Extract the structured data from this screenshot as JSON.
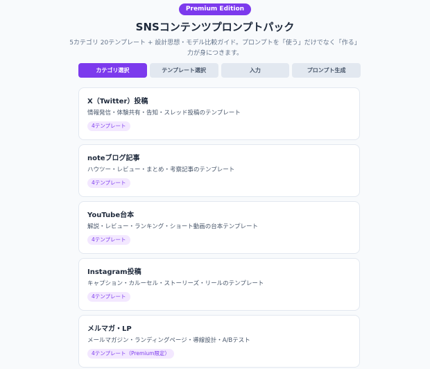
{
  "header": {
    "badge": "Premium Edition",
    "title": "SNSコンテンツプロンプトパック",
    "subtitle": "5カテゴリ 20テンプレート + 設計思想・モデル比較ガイド。プロンプトを「使う」だけでなく「作る」力が身につきます。"
  },
  "steps": [
    {
      "label": "カテゴリ選択",
      "active": true
    },
    {
      "label": "テンプレート選択",
      "active": false
    },
    {
      "label": "入力",
      "active": false
    },
    {
      "label": "プロンプト生成",
      "active": false
    }
  ],
  "categories": [
    {
      "title": "X（Twitter）投稿",
      "desc": "情報発信・体験共有・告知・スレッド投稿のテンプレート",
      "tag": "4テンプレート"
    },
    {
      "title": "noteブログ記事",
      "desc": "ハウツー・レビュー・まとめ・考察記事のテンプレート",
      "tag": "4テンプレート"
    },
    {
      "title": "YouTube台本",
      "desc": "解説・レビュー・ランキング・ショート動画の台本テンプレート",
      "tag": "4テンプレート"
    },
    {
      "title": "Instagram投稿",
      "desc": "キャプション・カルーセル・ストーリーズ・リールのテンプレート",
      "tag": "4テンプレート"
    },
    {
      "title": "メルマガ・LP",
      "desc": "メールマガジン・ランディングページ・導線設計・A/Bテスト",
      "tag": "4テンプレート（Premium限定）"
    }
  ],
  "colors": {
    "accent": "#7c3aed",
    "tag_bg": "#f3e8ff",
    "step_inactive": "#e2e8f0"
  }
}
